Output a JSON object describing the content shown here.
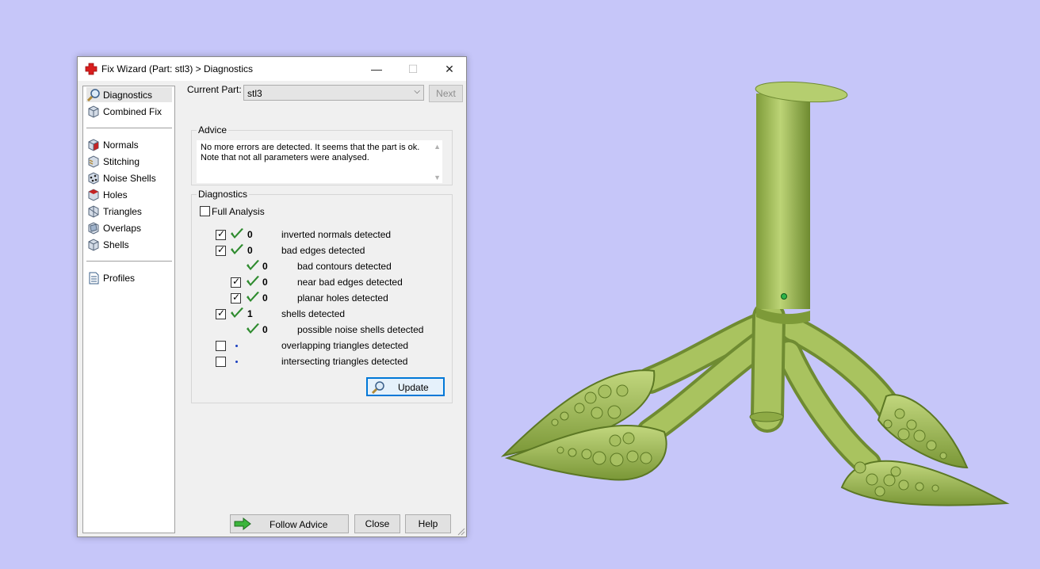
{
  "window": {
    "title": "Fix Wizard (Part: stl3) > Diagnostics",
    "minimize": "—",
    "maximize": "☐",
    "close": "✕"
  },
  "sidebar": {
    "items": [
      {
        "label": "Diagnostics",
        "icon": "magnifier-icon"
      },
      {
        "label": "Combined Fix",
        "icon": "cube-icon"
      },
      {
        "label": "Normals",
        "icon": "normals-cube-icon"
      },
      {
        "label": "Stitching",
        "icon": "stitching-icon"
      },
      {
        "label": "Noise Shells",
        "icon": "noise-shells-icon"
      },
      {
        "label": "Holes",
        "icon": "holes-icon"
      },
      {
        "label": "Triangles",
        "icon": "triangles-icon"
      },
      {
        "label": "Overlaps",
        "icon": "overlaps-icon"
      },
      {
        "label": "Shells",
        "icon": "shells-icon"
      },
      {
        "label": "Profiles",
        "icon": "profiles-icon"
      }
    ]
  },
  "current_part": {
    "label": "Current Part:",
    "value": "stl3"
  },
  "next_button": "Next",
  "advice": {
    "title": "Advice",
    "line1": "No more errors are detected. It seems that the part is ok.",
    "line2": "Note that not all parameters were analysed."
  },
  "diagnostics": {
    "title": "Diagnostics",
    "full_analysis": "Full Analysis",
    "rows": [
      {
        "checked": true,
        "status": "ok",
        "count": "0",
        "label": "inverted normals detected"
      },
      {
        "checked": true,
        "status": "ok",
        "count": "0",
        "label": "bad edges detected"
      },
      {
        "checked": null,
        "status": "ok",
        "count": "0",
        "label": "bad contours detected"
      },
      {
        "checked": true,
        "status": "ok",
        "count": "0",
        "label": "near bad edges detected"
      },
      {
        "checked": true,
        "status": "ok",
        "count": "0",
        "label": "planar holes detected"
      },
      {
        "checked": true,
        "status": "ok",
        "count": "1",
        "label": "shells detected"
      },
      {
        "checked": null,
        "status": "ok",
        "count": "0",
        "label": "possible noise shells detected"
      },
      {
        "checked": false,
        "status": "none",
        "count": "",
        "label": "overlapping triangles detected"
      },
      {
        "checked": false,
        "status": "none",
        "count": "",
        "label": "intersecting triangles detected"
      }
    ],
    "update_button": "Update"
  },
  "footer": {
    "follow_advice": "Follow Advice",
    "close": "Close",
    "help": "Help"
  },
  "colors": {
    "viewport_bg": "#c6c6f9",
    "model_green": "#9cbb52",
    "check_green": "#2e8b2e"
  }
}
